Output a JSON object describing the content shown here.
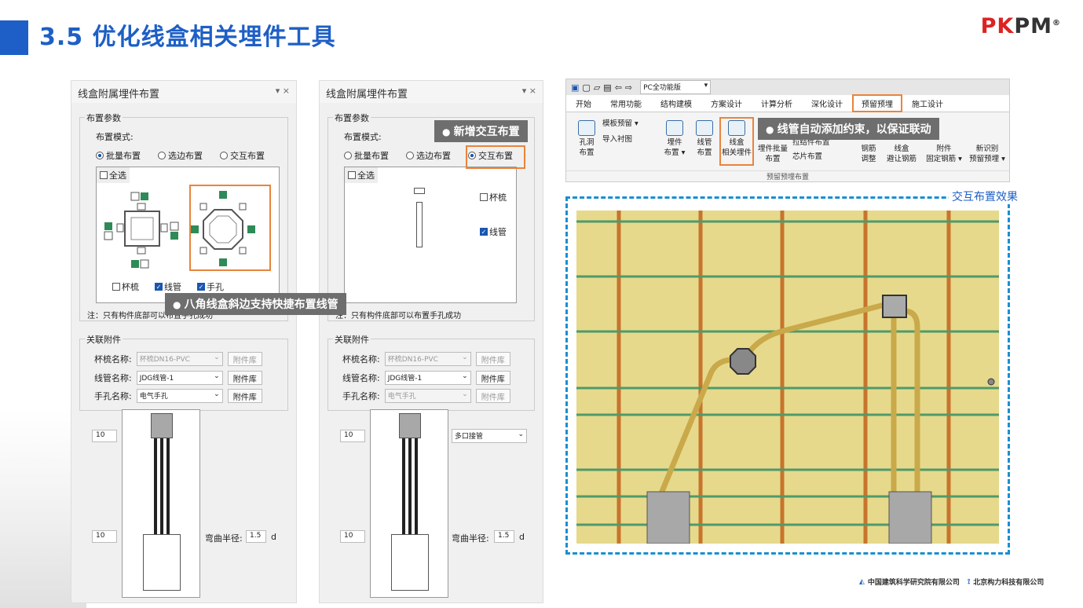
{
  "slide": {
    "title": "3.5 优化线盒相关埋件工具",
    "logo_left": "PK",
    "logo_right": "PM",
    "logo_reg": "®"
  },
  "colors": {
    "accent": "#1d5fc6",
    "highlight": "#e8843c",
    "callout_bg": "#6e6e6e"
  },
  "panel_left": {
    "title": "线盒附属埋件布置",
    "controls": "▾ ×",
    "group_layout": "布置参数",
    "mode_label": "布置模式:",
    "modes": [
      {
        "label": "批量布置",
        "selected": true
      },
      {
        "label": "选边布置",
        "selected": false
      },
      {
        "label": "交互布置",
        "selected": false
      }
    ],
    "select_all": "全选",
    "items": [
      {
        "label": "杯梳",
        "checked": false
      },
      {
        "label": "线管",
        "checked": true
      },
      {
        "label": "手孔",
        "checked": true
      }
    ],
    "note": "注：只有构件底部可以布置手孔成功",
    "group_assoc": "关联附件",
    "fields": [
      {
        "label": "杯梳名称:",
        "value": "杯梳DN16-PVC",
        "disabled": true,
        "btn": "附件库"
      },
      {
        "label": "线管名称:",
        "value": "JDG线管-1",
        "disabled": false,
        "btn": "附件库"
      },
      {
        "label": "手孔名称:",
        "value": "电气手孔",
        "disabled": false,
        "btn": "附件库"
      }
    ],
    "num_top": "10",
    "num_bottom": "10",
    "bend_label": "弯曲半径:",
    "bend_value": "1.5",
    "bend_unit": "d"
  },
  "panel_right": {
    "title": "线盒附属埋件布置",
    "controls": "▾ ×",
    "group_layout": "布置参数",
    "mode_label": "布置模式:",
    "modes": [
      {
        "label": "批量布置",
        "selected": false
      },
      {
        "label": "选边布置",
        "selected": false
      },
      {
        "label": "交互布置",
        "selected": true
      }
    ],
    "select_all": "全选",
    "items": [
      {
        "label": "杯梳",
        "checked": false
      },
      {
        "label": "线管",
        "checked": true
      }
    ],
    "note": "注：只有构件底部可以布置手孔成功",
    "group_assoc": "关联附件",
    "fields": [
      {
        "label": "杯梳名称:",
        "value": "杯梳DN16-PVC",
        "disabled": true,
        "btn": "附件库"
      },
      {
        "label": "线管名称:",
        "value": "JDG线管-1",
        "disabled": false,
        "btn": "附件库"
      },
      {
        "label": "手孔名称:",
        "value": "电气手孔",
        "disabled": true,
        "btn": "附件库"
      }
    ],
    "num_top": "10",
    "num_bottom": "10",
    "combo_joint": "多口接管",
    "bend_label": "弯曲半径:",
    "bend_value": "1.5",
    "bend_unit": "d"
  },
  "callouts": {
    "new_interactive": "新增交互布置",
    "octagon": "八角线盒斜边支持快捷布置线管",
    "auto_constraint": "线管自动添加约束，以保证联动"
  },
  "ribbon": {
    "version": "PC全功能版",
    "tabs": [
      {
        "label": "开始"
      },
      {
        "label": "常用功能"
      },
      {
        "label": "结构建模"
      },
      {
        "label": "方案设计"
      },
      {
        "label": "计算分析"
      },
      {
        "label": "深化设计"
      },
      {
        "label": "预留预埋",
        "selected": true
      },
      {
        "label": "施工设计"
      }
    ],
    "buttons": {
      "hole": "孔洞\n布置",
      "formwork": "模板预留 ▾",
      "import_liner": "导入衬图",
      "embed": "埋件\n布置 ▾",
      "conduit": "线管\n布置",
      "box_embed": "线盒\n相关埋件",
      "embed_batch": "埋件批量\n布置",
      "pull_embed": "拉结件布置",
      "chip": "芯片布置",
      "rebar_adjust": "钢筋\n调整",
      "box_avoid": "线盒\n避让钢筋",
      "fix_rebar": "附件\n固定钢筋 ▾",
      "new_identify": "新识别\n预留预埋 ▾"
    },
    "group_label": "预留预埋布置"
  },
  "effect_label": "交互布置效果",
  "footer": {
    "org1": "中国建筑科学研究院有限公司",
    "org2": "北京构力科技有限公司"
  }
}
